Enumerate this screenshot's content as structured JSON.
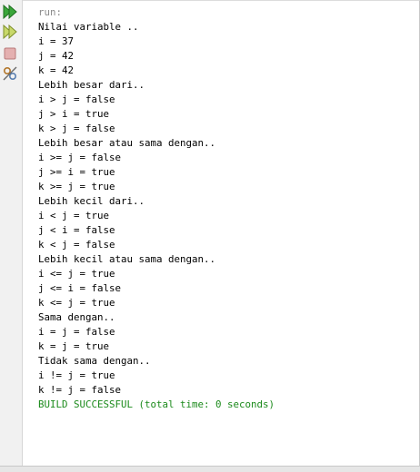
{
  "toolbar": {
    "buttons": [
      {
        "name": "rerun-icon",
        "interactable": true
      },
      {
        "name": "rerun-with-options-icon",
        "interactable": true
      },
      {
        "name": "stop-icon",
        "interactable": false
      },
      {
        "name": "settings-icon",
        "interactable": true
      }
    ]
  },
  "colors": {
    "run_text": "#8a8a8a",
    "normal_text": "#000000",
    "success_text": "#1b8a1b",
    "icon_green": "#2fa02f"
  },
  "output": {
    "lines": [
      {
        "text": "run:",
        "style": "run"
      },
      {
        "text": "Nilai variable ..",
        "style": "normal"
      },
      {
        "text": "i = 37",
        "style": "normal"
      },
      {
        "text": "j = 42",
        "style": "normal"
      },
      {
        "text": "k = 42",
        "style": "normal"
      },
      {
        "text": "Lebih besar dari..",
        "style": "normal"
      },
      {
        "text": "i > j = false",
        "style": "normal"
      },
      {
        "text": "j > i = true",
        "style": "normal"
      },
      {
        "text": "k > j = false",
        "style": "normal"
      },
      {
        "text": "Lebih besar atau sama dengan..",
        "style": "normal"
      },
      {
        "text": "i >= j = false",
        "style": "normal"
      },
      {
        "text": "j >= i = true",
        "style": "normal"
      },
      {
        "text": "k >= j = true",
        "style": "normal"
      },
      {
        "text": "Lebih kecil dari..",
        "style": "normal"
      },
      {
        "text": "i < j = true",
        "style": "normal"
      },
      {
        "text": "j < i = false",
        "style": "normal"
      },
      {
        "text": "k < j = false",
        "style": "normal"
      },
      {
        "text": "Lebih kecil atau sama dengan..",
        "style": "normal"
      },
      {
        "text": "i <= j = true",
        "style": "normal"
      },
      {
        "text": "j <= i = false",
        "style": "normal"
      },
      {
        "text": "k <= j = true",
        "style": "normal"
      },
      {
        "text": "Sama dengan..",
        "style": "normal"
      },
      {
        "text": "i = j = false",
        "style": "normal"
      },
      {
        "text": "k = j = true",
        "style": "normal"
      },
      {
        "text": "Tidak sama dengan..",
        "style": "normal"
      },
      {
        "text": "i != j = true",
        "style": "normal"
      },
      {
        "text": "k != j = false",
        "style": "normal"
      },
      {
        "text": "BUILD SUCCESSFUL (total time: 0 seconds)",
        "style": "success"
      }
    ]
  }
}
